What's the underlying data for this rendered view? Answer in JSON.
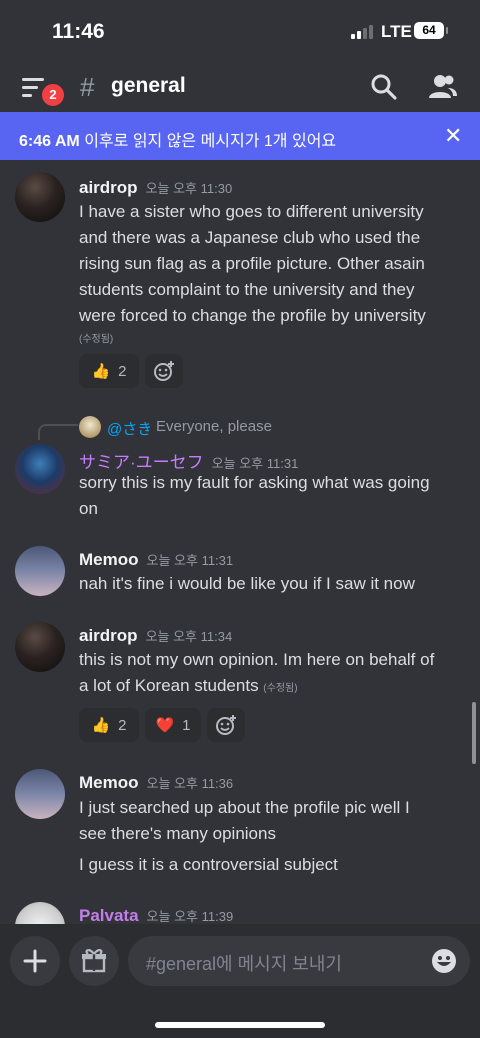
{
  "status_bar": {
    "time": "11:46",
    "network": "LTE",
    "battery": "64"
  },
  "header": {
    "badge_count": "2",
    "hash": "#",
    "channel_name": "general"
  },
  "banner": {
    "time": "6:46 AM",
    "text": " 이후로 읽지 않은 메시지가 1개 있어요",
    "close": "✕"
  },
  "messages": [
    {
      "author": "airdrop",
      "timestamp": "오늘 오후 11:30",
      "lines": [
        "I have a sister who goes to different university",
        "and there was a Japanese club who used the",
        "rising sun flag as a profile picture. Other asain",
        "students complaint to the university and they",
        "were forced to change the profile by university"
      ],
      "edited": "(수정됨)",
      "reactions": [
        {
          "emoji": "👍",
          "count": "2"
        }
      ]
    },
    {
      "reply": {
        "name": "@さき",
        "text": "Everyone, please"
      },
      "author": "サミア·ユーセフ",
      "author_color": "#c77dff",
      "timestamp": "오늘 오후 11:31",
      "lines": [
        "sorry this is my fault for asking what was going",
        "on"
      ]
    },
    {
      "author": "Memoo",
      "timestamp": "오늘 오후 11:31",
      "lines": [
        "nah it's fine i would be like you if I saw it now"
      ]
    },
    {
      "author": "airdrop",
      "timestamp": "오늘 오후 11:34",
      "lines": [
        "this is not my own opinion. Im here on behalf of",
        "a lot of Korean students"
      ],
      "edited": "(수정됨)",
      "reactions": [
        {
          "emoji": "👍",
          "count": "2"
        },
        {
          "emoji": "❤️",
          "count": "1"
        }
      ]
    },
    {
      "author": "Memoo",
      "timestamp": "오늘 오후 11:36",
      "lines": [
        "I just searched up about the profile pic well I",
        "see there's many opinions",
        "I guess it is a controversial subject"
      ]
    },
    {
      "author": "Palvata",
      "author_color": "#c27ee8",
      "timestamp": "오늘 오후 11:39",
      "lines": []
    }
  ],
  "composer": {
    "placeholder": "#general에 메시지 보내기"
  },
  "colors": {
    "background": "#313338",
    "banner": "#5865f2",
    "composer": "#2b2d31",
    "badge": "#f23f43"
  }
}
